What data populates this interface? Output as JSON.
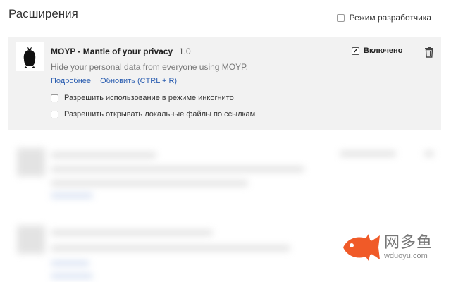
{
  "page": {
    "title": "Расширения",
    "dev_mode_label": "Режим разработчика"
  },
  "extension": {
    "name": "MOYP - Mantle of your privacy",
    "version": "1.0",
    "description": "Hide your personal data from everyone using MOYP.",
    "details_link": "Подробнее",
    "reload_link": "Обновить (CTRL + R)",
    "enabled_label": "Включено",
    "enabled": true,
    "option_incognito": "Разрешить использование в режиме инкогнито",
    "option_file_urls": "Разрешить открывать локальные файлы по ссылкам",
    "icon": "cloaked-figure-icon",
    "remove_icon": "trash-icon"
  },
  "watermark": {
    "chinese": "网多鱼",
    "url": "wduoyu.com",
    "icon": "fish-logo-icon",
    "fish_color": "#f05a28"
  },
  "colors": {
    "link": "#2a5db0",
    "card_bg": "#f2f2f2"
  }
}
